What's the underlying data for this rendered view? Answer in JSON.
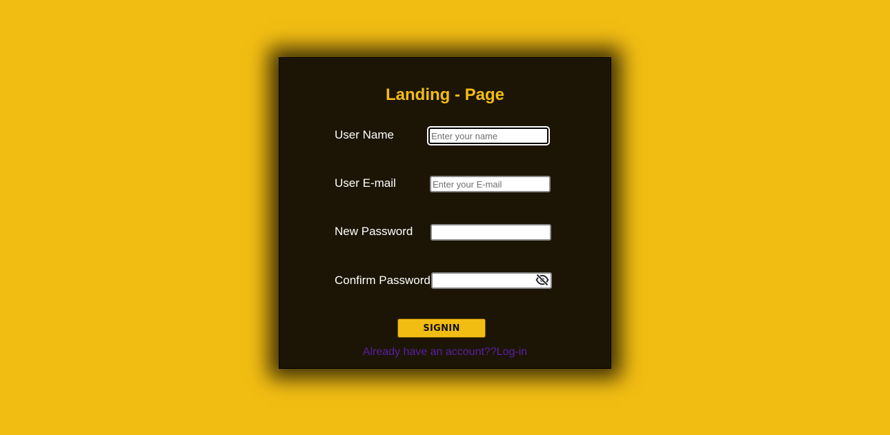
{
  "form": {
    "title": "Landing - Page",
    "fields": {
      "username": {
        "label": "User Name",
        "placeholder": "Enter your name",
        "value": ""
      },
      "email": {
        "label": "User E-mail",
        "placeholder": "Enter your E-mail",
        "value": ""
      },
      "new_password": {
        "label": "New Password",
        "placeholder": "",
        "value": ""
      },
      "confirm_password": {
        "label": "Confirm Password",
        "placeholder": "",
        "value": "",
        "toggle_icon": "eye-slash-icon"
      }
    },
    "submit_label": "SIGNIN",
    "login_link": "Already have an account??Log-in"
  },
  "colors": {
    "background": "#f2bd13",
    "card": "#1c1505",
    "accent": "#f2bd13",
    "link": "#5a1fa6",
    "label": "#ffffff"
  }
}
